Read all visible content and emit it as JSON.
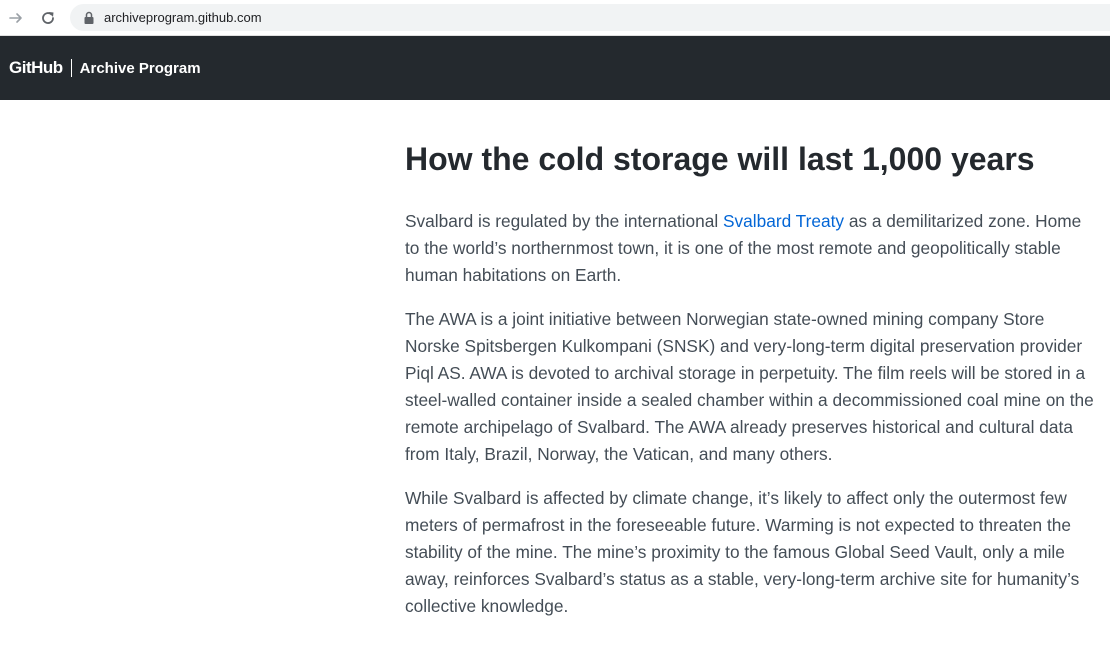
{
  "browser": {
    "url": "archiveprogram.github.com",
    "forward_icon": "arrow-right-icon",
    "reload_icon": "reload-icon",
    "lock_icon": "lock-icon"
  },
  "header": {
    "logo": "GitHub",
    "program": "Archive Program",
    "background": "#24292e"
  },
  "article": {
    "title": "How the cold storage will last 1,000 years",
    "p1": {
      "before": "Svalbard is regulated by the international ",
      "link": "Svalbard Treaty",
      "after": " as a demilitarized zone. Home to the world’s northernmost town, it is one of the most remote and geopolitically stable human habitations on Earth."
    },
    "p2": "The AWA is a joint initiative between Norwegian state-owned mining company Store Norske Spitsbergen Kulkompani (SNSK) and very-long-term digital preservation provider Piql AS. AWA is devoted to archival storage in perpetuity. The film reels will be stored in a steel-walled container inside a sealed chamber within a decommissioned coal mine on the remote archipelago of Svalbard. The AWA already preserves historical and cultural data from Italy, Brazil, Norway, the Vatican, and many others.",
    "p3": "While Svalbard is affected by climate change, it’s likely to affect only the outermost few meters of permafrost in the foreseeable future. Warming is not expected to threaten the stability of the mine. The mine’s proximity to the famous Global Seed Vault, only a mile away, reinforces Svalbard’s status as a stable, very-long-term archive site for humanity’s collective knowledge.",
    "link_color": "#0366d6",
    "text_color": "#444d56",
    "title_color": "#24292e"
  }
}
